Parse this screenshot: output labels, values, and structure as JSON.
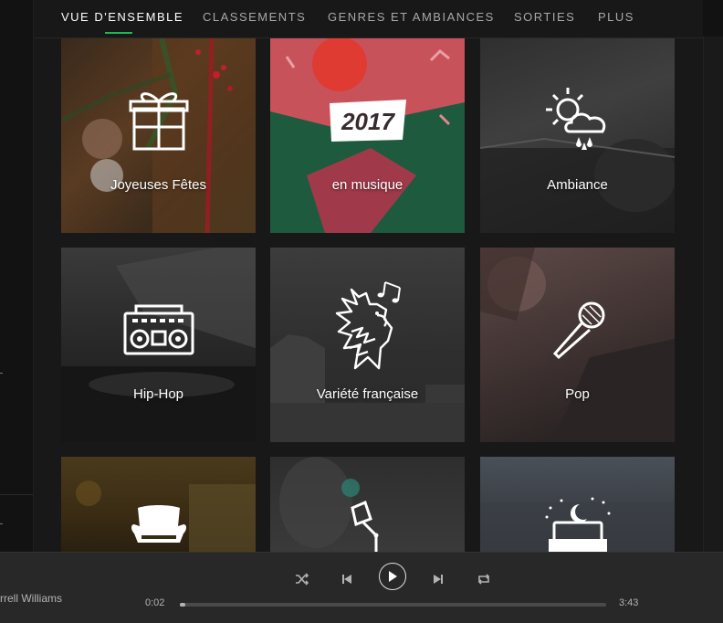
{
  "nav": {
    "tabs": [
      {
        "label": "VUE D'ENSEMBLE",
        "active": true
      },
      {
        "label": "CLASSEMENTS",
        "active": false
      },
      {
        "label": "GENRES ET AMBIANCES",
        "active": false
      },
      {
        "label": "SORTIES",
        "active": false
      },
      {
        "label": "PLUS",
        "active": false
      }
    ]
  },
  "tiles": [
    {
      "label": "Joyeuses Fêtes",
      "icon": "gift-icon"
    },
    {
      "label": "en musique",
      "badge": "2017",
      "icon": "year-badge"
    },
    {
      "label": "Ambiance",
      "icon": "weather-icon"
    },
    {
      "label": "Hip-Hop",
      "icon": "boombox-icon"
    },
    {
      "label": "Variété française",
      "icon": "rooster-icon"
    },
    {
      "label": "Pop",
      "icon": "microphone-icon"
    },
    {
      "label": "",
      "icon": "armchair-icon"
    },
    {
      "label": "",
      "icon": "lamp-icon"
    },
    {
      "label": "",
      "icon": "sleep-icon"
    }
  ],
  "player": {
    "track_fragment": "rrell Williams",
    "current_time": "0:02",
    "total_time": "3:43",
    "progress_fraction": 0.009,
    "controls": [
      "shuffle-icon",
      "previous-icon",
      "play-icon",
      "next-icon",
      "repeat-icon"
    ]
  },
  "colors": {
    "accent": "#1db954",
    "background": "#121212",
    "panel": "#181818",
    "player": "#282828"
  }
}
